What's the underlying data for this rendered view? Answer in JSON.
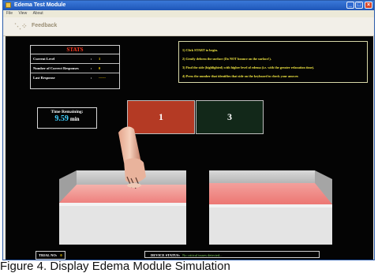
{
  "window": {
    "title": "Edema Test Module",
    "controls": {
      "minimize": "_",
      "maximize": "□",
      "close": "×"
    }
  },
  "menu": {
    "items": [
      "File",
      "View",
      "About"
    ]
  },
  "toolbar": {
    "feedback_label": "Feedback",
    "feedback_icon": "sparkle-icon"
  },
  "stats": {
    "title": "STATS",
    "rows": [
      {
        "label": "Current Level",
        "separator": ":",
        "value": "1"
      },
      {
        "label": "Number of Correct Responses",
        "separator": ":",
        "value": "0"
      },
      {
        "label": "Last Response",
        "separator": ":",
        "value": "------"
      }
    ]
  },
  "instructions": [
    "1) Click START to begin.",
    "2) Gently deform the surface (Do NOT bounce on the surface!).",
    "3) Find the side (highlighted) with higher level of edema (i.e. with the greater relaxation time).",
    "4) Press the number that identifies that side on the keyboard to check your answer."
  ],
  "timer": {
    "label": "Time Remaining:",
    "value": "9.59",
    "unit": "min"
  },
  "choices": [
    {
      "label": "1",
      "color": "#b43a24"
    },
    {
      "label": "3",
      "color": "#122819"
    }
  ],
  "footer": {
    "trial_label": "TRIAL NO:",
    "trial_value": "0",
    "device_label": "DEVICE STATUS:",
    "device_value": "No critical issues detected..."
  },
  "caption": "Figure 4.  Display Edema Module Simulation ",
  "colors": {
    "stage_bg": "#040404",
    "stats_title": "#ff3b22",
    "instruction_text": "#f1e642",
    "timer_value": "#3fd0ff",
    "tissue_pink": "#f08d8b",
    "tissue_grey": "#cfcfcf"
  }
}
